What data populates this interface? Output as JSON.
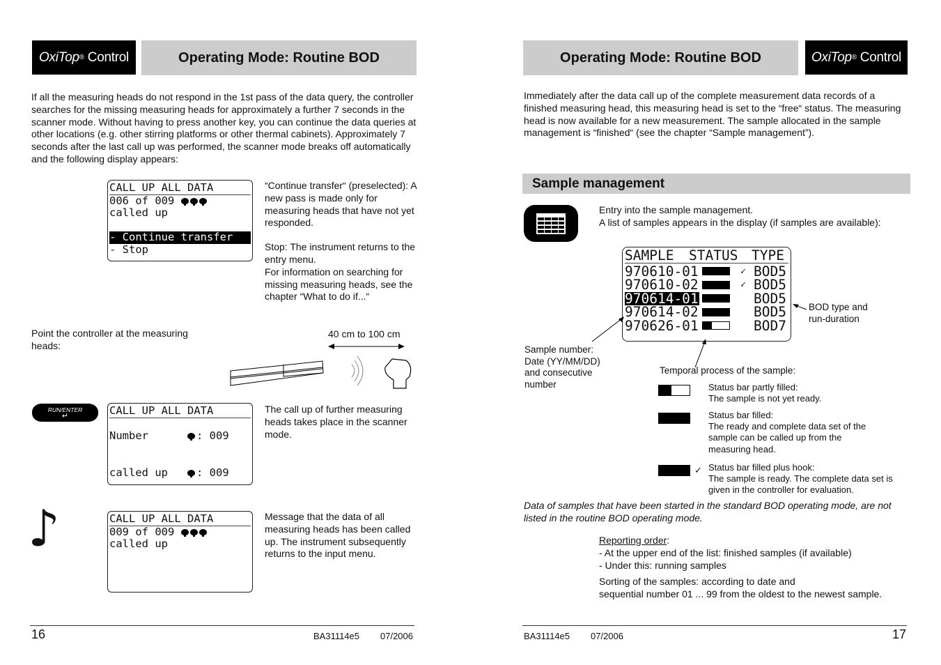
{
  "left_page": {
    "logo": {
      "brand": "OxiTop",
      "reg": "®",
      "product": "Control"
    },
    "header_title": "Operating Mode: Routine BOD",
    "intro": "If all the measuring heads do not respond in the 1st pass of the data query, the controller searches for the missing measuring heads for approximately a further 7 seconds in the scanner mode. Without having to press another key, you can continue the data queries at other locations (e.g. other stirring platforms or other thermal cabinets). Approximately 7 seconds after the last call up was performed, the scanner mode breaks off automatically and the following display appears:",
    "display1": {
      "title": "CALL UP ALL DATA",
      "line1": "006 of 009",
      "line2": "called up",
      "option_selected": "- Continue transfer",
      "option2": "- Stop"
    },
    "display1_desc": {
      "p1": "“Continue transfer“ (preselected): A new pass is made only for measuring heads that have not yet responded.",
      "p2": "Stop: The  instrument returns to the entry menu.",
      "p3": "For information on searching for missing measuring heads, see the chapter “What to do if...“"
    },
    "point_text": "Point the controller at the measuring heads:",
    "distance_label": "40 cm to 100 cm",
    "key_label": "RUN/ENTER",
    "display2": {
      "title": "CALL UP ALL DATA",
      "number_label": "Number",
      "number_value": ": 009",
      "called_label": "called up",
      "called_value": ": 009"
    },
    "display2_desc": "The call up of further measuring heads takes place in the scanner mode.",
    "display3": {
      "title": "CALL UP ALL DATA",
      "line1": "009 of 009",
      "line2": "called up"
    },
    "display3_desc": "Message that the data of all measuring heads has been called up. The instrument subsequently returns to the input menu.",
    "footer": {
      "page": "16",
      "doc": "BA31114e5",
      "date": "07/2006"
    }
  },
  "right_page": {
    "logo": {
      "brand": "OxiTop",
      "reg": "®",
      "product": "Control"
    },
    "header_title": "Operating Mode: Routine BOD",
    "intro": "Immediately after the data call up of the complete measurement data records of a finished measuring head, this measuring head is set to the “free“ status. The measuring head is now available for a new measurement. The sample allocated in the sample management  is “finished“ (see the chapter “Sample management”).",
    "section_title": "Sample management",
    "entry_line1": "Entry into the sample management.",
    "entry_line2": "A list of samples appears in the display (if samples are available):",
    "sample_display": {
      "headers": {
        "sample": "SAMPLE",
        "status": "STATUS",
        "type": "TYPE"
      },
      "rows": [
        {
          "sample": "970610-01",
          "progress": 1.0,
          "check": "✓",
          "type": "BOD5",
          "selected": false
        },
        {
          "sample": "970610-02",
          "progress": 1.0,
          "check": "✓",
          "type": "BOD5",
          "selected": false
        },
        {
          "sample": "970614-01",
          "progress": 1.0,
          "check": "",
          "type": "BOD5",
          "selected": true
        },
        {
          "sample": "970614-02",
          "progress": 1.0,
          "check": "",
          "type": "BOD5",
          "selected": false
        },
        {
          "sample": "970626-01",
          "progress": 0.35,
          "check": "",
          "type": "BOD7",
          "selected": false
        }
      ]
    },
    "callout_type": "BOD type and run-duration",
    "callout_sample": "Sample number: Date (YY/MM/DD) and consecutive number",
    "callout_temporal": "Temporal process of the sample:",
    "legend": [
      {
        "progress": 0.4,
        "hook": false,
        "title": "Status bar partly filled:",
        "desc": "The sample is not yet ready."
      },
      {
        "progress": 1.0,
        "hook": false,
        "title": "Status bar filled:",
        "desc": "The ready and complete data set of the sample can be called up from the measuring head."
      },
      {
        "progress": 1.0,
        "hook": true,
        "title": "Status bar filled plus hook:",
        "desc": "The sample is ready. The complete data set is given in the controller for evaluation."
      }
    ],
    "note_italic": "Data of samples that have been started in the standard BOD operating mode, are not listed in the routine BOD operating mode.",
    "reporting_label": "Reporting order",
    "reporting_items": [
      "- At the upper end of the list: finished samples (if available)",
      "- Under this: running samples"
    ],
    "sorting_line1": "Sorting of the samples: according to date and",
    "sorting_line2": "sequential number 01 ... 99 from the oldest to the newest sample.",
    "footer": {
      "page": "17",
      "doc": "BA31114e5",
      "date": "07/2006"
    }
  }
}
